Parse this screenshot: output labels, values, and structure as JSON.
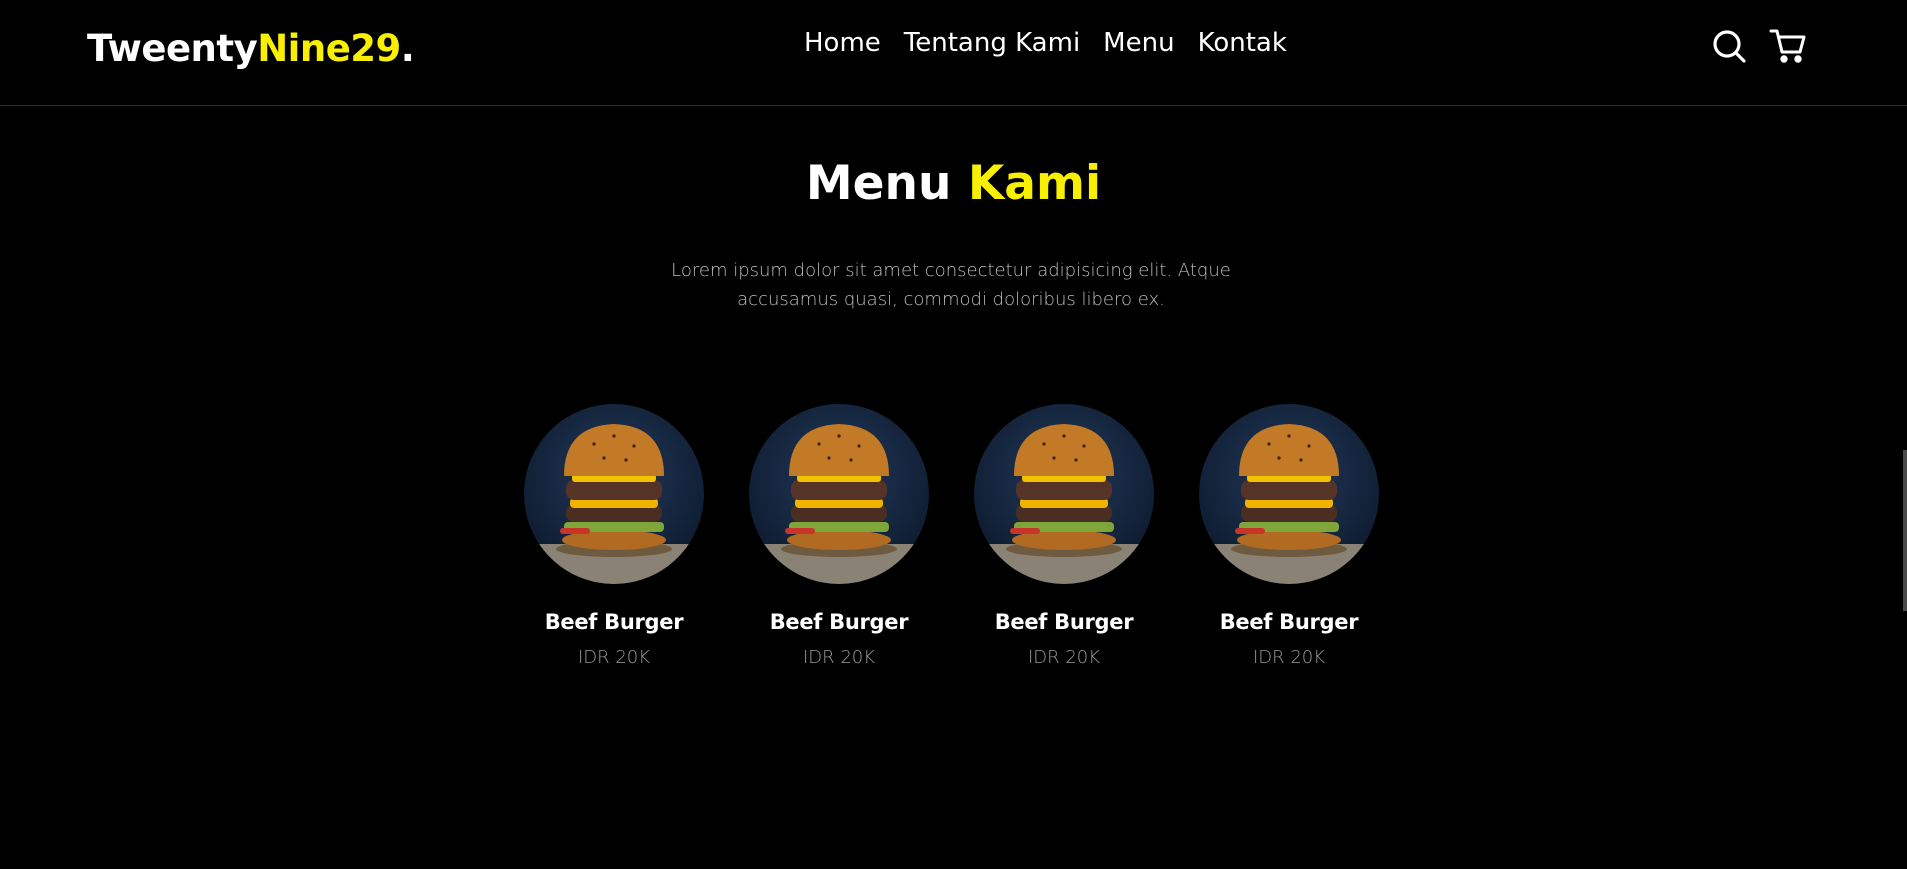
{
  "brand": {
    "name_main": "Tweenty",
    "name_accent": "Nine29",
    "dot": "."
  },
  "nav": {
    "links": [
      {
        "label": "Home"
      },
      {
        "label": "Tentang Kami"
      },
      {
        "label": "Menu"
      },
      {
        "label": "Kontak"
      }
    ],
    "icons": [
      "search-icon",
      "cart-icon"
    ]
  },
  "section": {
    "title_main": "Menu",
    "title_accent": "Kami",
    "description": "Lorem ipsum dolor sit amet consectetur adipisicing elit. Atque accusamus quasi, commodi doloribus libero ex."
  },
  "menu_items": [
    {
      "name": "Beef Burger",
      "price": "IDR 20K"
    },
    {
      "name": "Beef Burger",
      "price": "IDR 20K"
    },
    {
      "name": "Beef Burger",
      "price": "IDR 20K"
    },
    {
      "name": "Beef Burger",
      "price": "IDR 20K"
    }
  ],
  "colors": {
    "background": "#000000",
    "accent": "#f8f000",
    "text": "#ffffff",
    "muted": "#9a9a9a"
  }
}
